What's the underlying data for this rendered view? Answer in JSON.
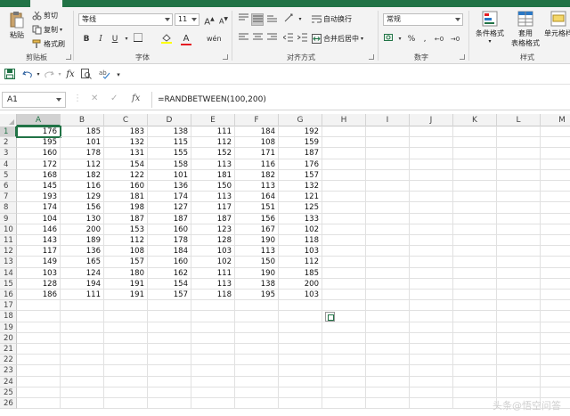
{
  "ribbon": {
    "clipboard": {
      "paste": "粘贴",
      "cut": "剪切",
      "copy": "复制",
      "format_painter": "格式刷",
      "group_label": "剪贴板"
    },
    "font": {
      "font_name": "等线",
      "font_size": "11",
      "bold": "B",
      "italic": "I",
      "underline": "U",
      "group_label": "字体"
    },
    "alignment": {
      "wrap_text": "自动换行",
      "merge_center": "合并后居中",
      "group_label": "对齐方式"
    },
    "number": {
      "format": "常规",
      "group_label": "数字"
    },
    "styles": {
      "conditional_formatting": "条件格式",
      "table_format_line1": "套用",
      "table_format_line2": "表格格式",
      "cell_styles": "单元格样",
      "group_label": "样式"
    }
  },
  "formula_bar": {
    "name_box": "A1",
    "cancel": "✕",
    "enter": "✓",
    "fx": "fx",
    "formula": "=RANDBETWEEN(100,200)"
  },
  "columns": [
    "A",
    "B",
    "C",
    "D",
    "E",
    "F",
    "G",
    "H",
    "I",
    "J",
    "K",
    "L",
    "M"
  ],
  "row_numbers": [
    "1",
    "2",
    "3",
    "4",
    "5",
    "6",
    "7",
    "8",
    "9",
    "10",
    "11",
    "12",
    "13",
    "14",
    "15",
    "16",
    "17",
    "18",
    "19",
    "20",
    "21",
    "22",
    "23",
    "24",
    "25",
    "26"
  ],
  "rows": [
    [
      "176",
      "185",
      "183",
      "138",
      "111",
      "184",
      "192"
    ],
    [
      "195",
      "101",
      "132",
      "115",
      "112",
      "108",
      "159"
    ],
    [
      "160",
      "178",
      "131",
      "155",
      "152",
      "171",
      "187"
    ],
    [
      "172",
      "112",
      "154",
      "158",
      "113",
      "116",
      "176"
    ],
    [
      "168",
      "182",
      "122",
      "101",
      "181",
      "182",
      "157"
    ],
    [
      "145",
      "116",
      "160",
      "136",
      "150",
      "113",
      "132"
    ],
    [
      "193",
      "129",
      "181",
      "174",
      "113",
      "164",
      "121"
    ],
    [
      "174",
      "156",
      "198",
      "127",
      "117",
      "151",
      "125"
    ],
    [
      "104",
      "130",
      "187",
      "187",
      "187",
      "156",
      "133"
    ],
    [
      "146",
      "200",
      "153",
      "160",
      "123",
      "167",
      "102"
    ],
    [
      "143",
      "189",
      "112",
      "178",
      "128",
      "190",
      "118"
    ],
    [
      "117",
      "136",
      "108",
      "184",
      "103",
      "113",
      "103"
    ],
    [
      "149",
      "165",
      "157",
      "160",
      "102",
      "150",
      "112"
    ],
    [
      "103",
      "124",
      "180",
      "162",
      "111",
      "190",
      "185"
    ],
    [
      "128",
      "194",
      "191",
      "154",
      "113",
      "138",
      "200"
    ],
    [
      "186",
      "111",
      "191",
      "157",
      "118",
      "195",
      "103"
    ]
  ],
  "active_cell": "A1",
  "watermark": "头条@悟空问答",
  "colors": {
    "accent": "#217346",
    "ribbon_bg": "#f3f3f3",
    "header_bg": "#f3f3f3"
  }
}
